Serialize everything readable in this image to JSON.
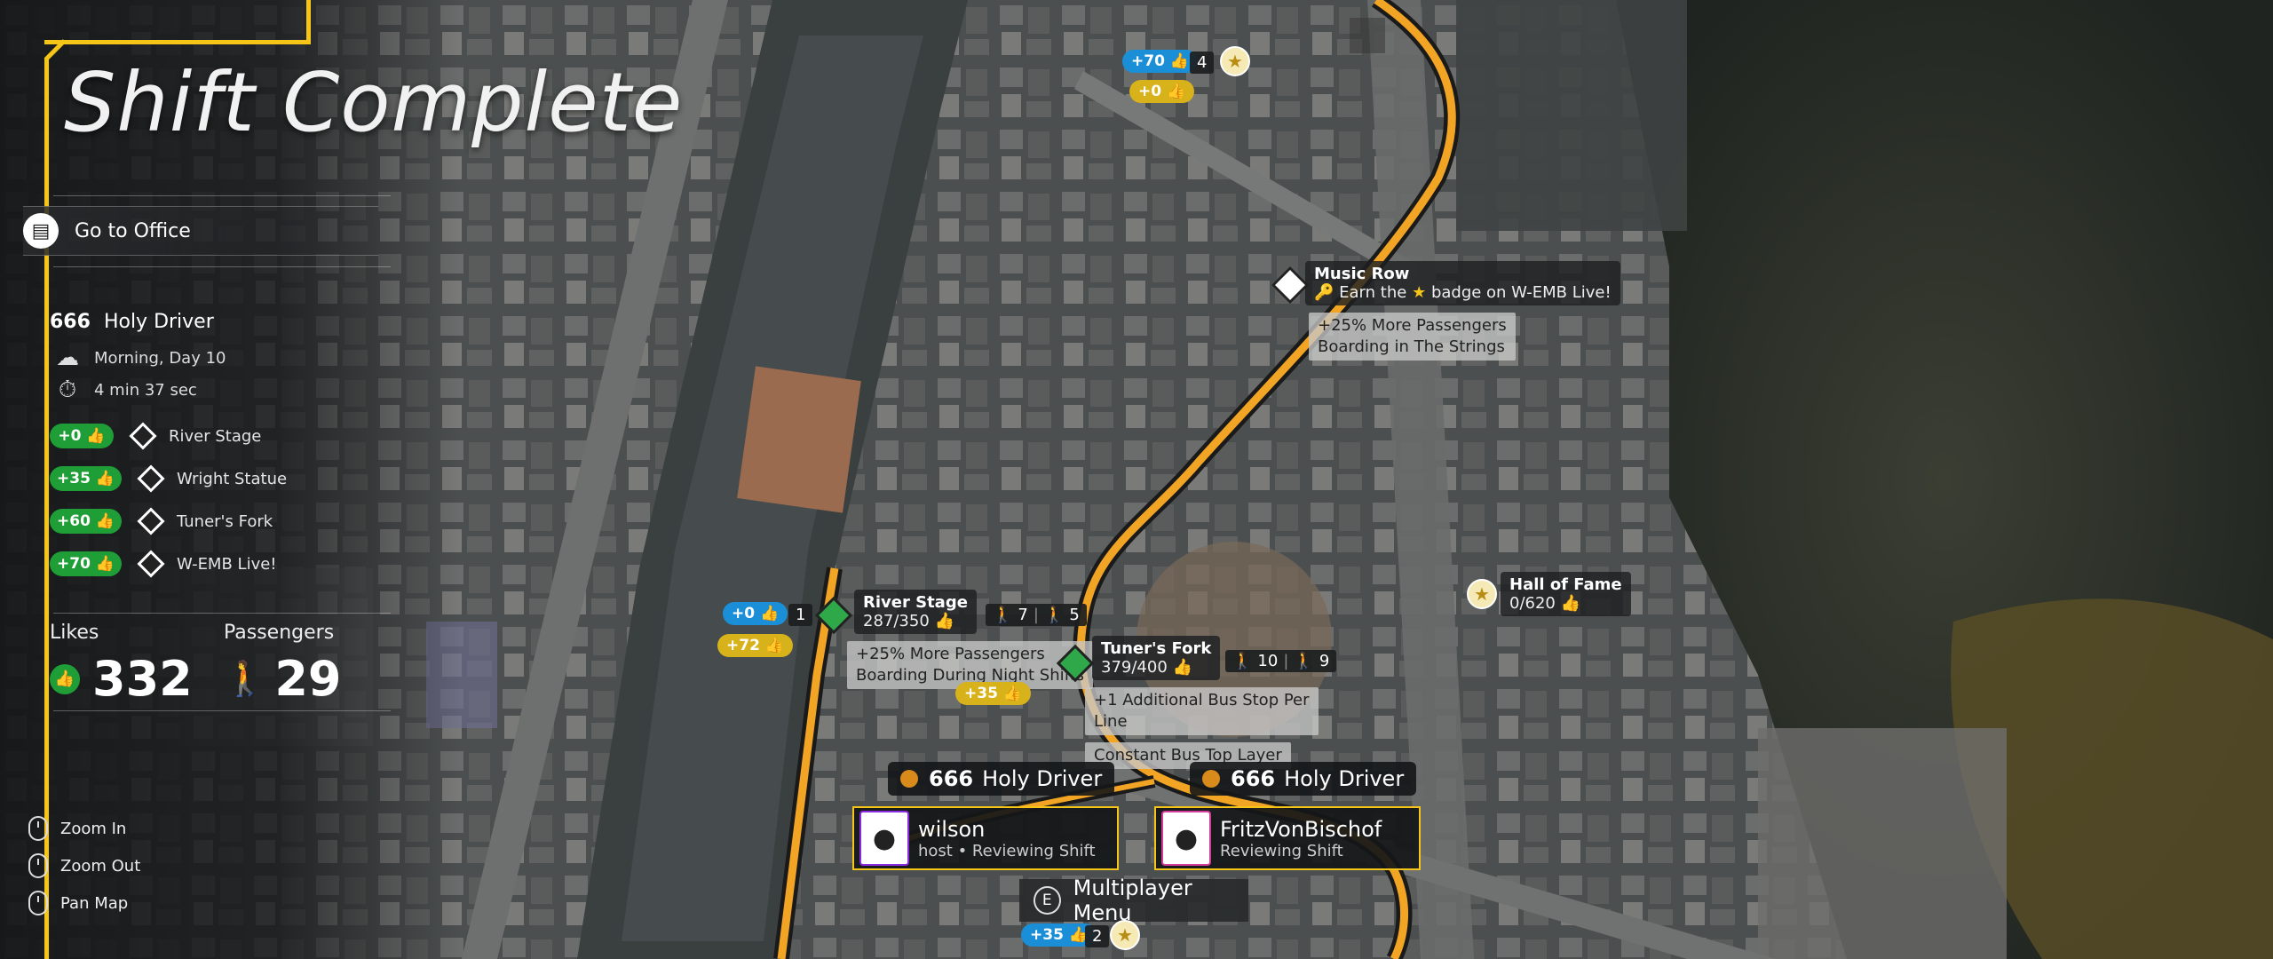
{
  "title": "Shift Complete",
  "goto_office": "Go to Office",
  "driver": {
    "number": "666",
    "name": "Holy Driver"
  },
  "weather_time": "Morning, Day 10",
  "duration": "4 min 37 sec",
  "bonuses": [
    {
      "value": "+0",
      "label": "River Stage"
    },
    {
      "value": "+35",
      "label": "Wright Statue"
    },
    {
      "value": "+60",
      "label": "Tuner's Fork"
    },
    {
      "value": "+70",
      "label": "W-EMB Live!"
    }
  ],
  "totals": {
    "likes_label": "Likes",
    "likes": "332",
    "passengers_label": "Passengers",
    "passengers": "29"
  },
  "controls": [
    "Zoom In",
    "Zoom Out",
    "Pan Map"
  ],
  "map": {
    "music_row": {
      "name": "Music Row",
      "desc": "Earn the",
      "desc2": "badge on W-EMB Live!"
    },
    "strings_bonus": [
      "+25% More Passengers",
      "Boarding in The Strings"
    ],
    "hall_of_fame": {
      "name": "Hall of Fame",
      "count": "0/620"
    },
    "river_stage": {
      "name": "River Stage",
      "count": "287/350",
      "rank": "1",
      "in": "7",
      "out": "5"
    },
    "night_bonus": [
      "+25% More Passengers",
      "Boarding During Night Shifts"
    ],
    "tuners_fork": {
      "name": "Tuner's Fork",
      "count": "379/400",
      "in": "10",
      "out": "9"
    },
    "extra_stop": [
      "+1 Additional Bus Stop Per",
      "Line"
    ],
    "constant_layer": "Constant Bus Top Layer",
    "chips": {
      "top_blue": "+70",
      "top_count": "4",
      "top_yellow": "+0",
      "river_blue": "+0",
      "river_yellow": "+72",
      "tuners_yellow": "+35",
      "bottom_blue": "+35",
      "bottom_count": "2"
    }
  },
  "players": [
    {
      "number": "666",
      "name": "Holy Driver",
      "user": "wilson",
      "status": "host • Reviewing Shift"
    },
    {
      "number": "666",
      "name": "Holy Driver",
      "user": "FritzVonBischof",
      "status": "Reviewing Shift"
    }
  ],
  "multiplayer": {
    "key": "E",
    "label": "Multiplayer Menu"
  },
  "colors": {
    "accent": "#f5c518",
    "like_green": "#1f9d37",
    "chip_blue": "#1a8fd8",
    "chip_yellow": "#d8b21a"
  }
}
